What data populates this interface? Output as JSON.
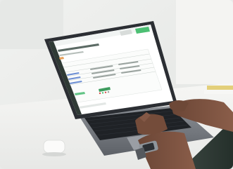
{
  "photo": {
    "subject": "laptop-on-desk",
    "colors": {
      "wall": "#eeefed",
      "desk": "#f5f5f3",
      "laptop_body": "#2b2e33",
      "keyboard": "#1c1e22",
      "screen_bg": "#ffffff",
      "accent_green": "#3fb56a",
      "accent_blue": "#4a76c8",
      "accent_red": "#d9534f",
      "skin": "#7a5240",
      "sleeve": "#2f3b36",
      "watch": "#9aa0a6"
    },
    "icons": [
      "sidebar-nav-icon"
    ]
  }
}
